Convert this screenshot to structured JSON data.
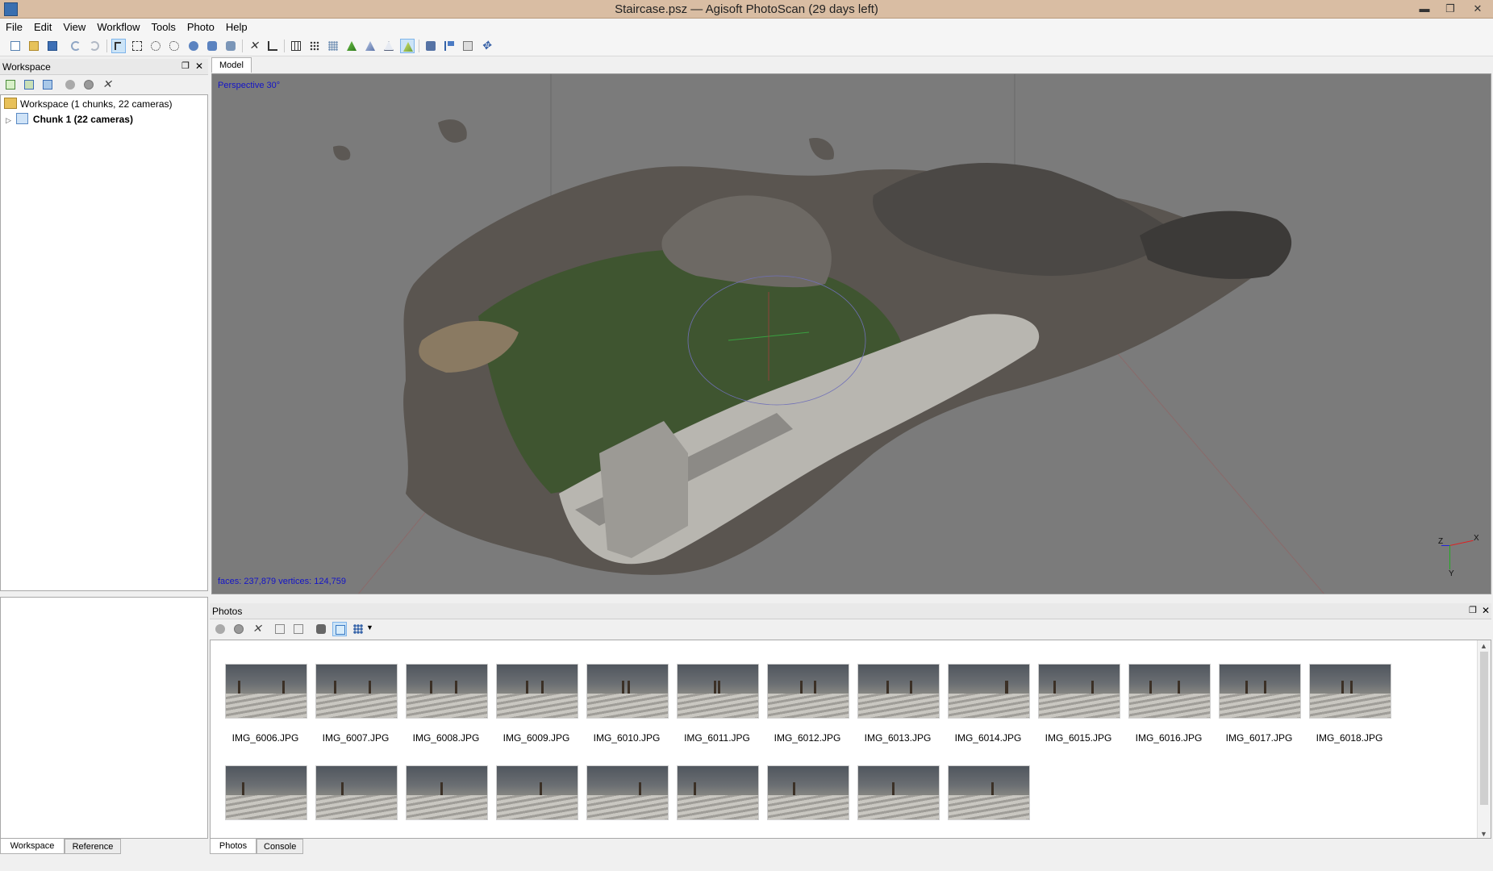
{
  "window": {
    "title": "Staircase.psz — Agisoft PhotoScan (29 days left)",
    "min": "▬",
    "restore": "❐",
    "close": "✕"
  },
  "menu": [
    "File",
    "Edit",
    "View",
    "Workflow",
    "Tools",
    "Photo",
    "Help"
  ],
  "workspace": {
    "header": "Workspace",
    "root_label": "Workspace (1 chunks, 22 cameras)",
    "chunk_label": "Chunk 1 (22 cameras)",
    "tabs": [
      "Workspace",
      "Reference"
    ]
  },
  "model": {
    "tab": "Model",
    "projection": "Perspective 30°",
    "stats": "faces: 237,879 vertices: 124,759",
    "axes": {
      "x": "X",
      "y": "Y",
      "z": "Z"
    }
  },
  "photos": {
    "header": "Photos",
    "tabs": [
      "Photos",
      "Console"
    ],
    "row1": [
      "IMG_6006.JPG",
      "IMG_6007.JPG",
      "IMG_6008.JPG",
      "IMG_6009.JPG",
      "IMG_6010.JPG",
      "IMG_6011.JPG",
      "IMG_6012.JPG",
      "IMG_6013.JPG",
      "IMG_6014.JPG",
      "IMG_6015.JPG",
      "IMG_6016.JPG",
      "IMG_6017.JPG",
      "IMG_6018.JPG"
    ],
    "row2_count": 9
  }
}
